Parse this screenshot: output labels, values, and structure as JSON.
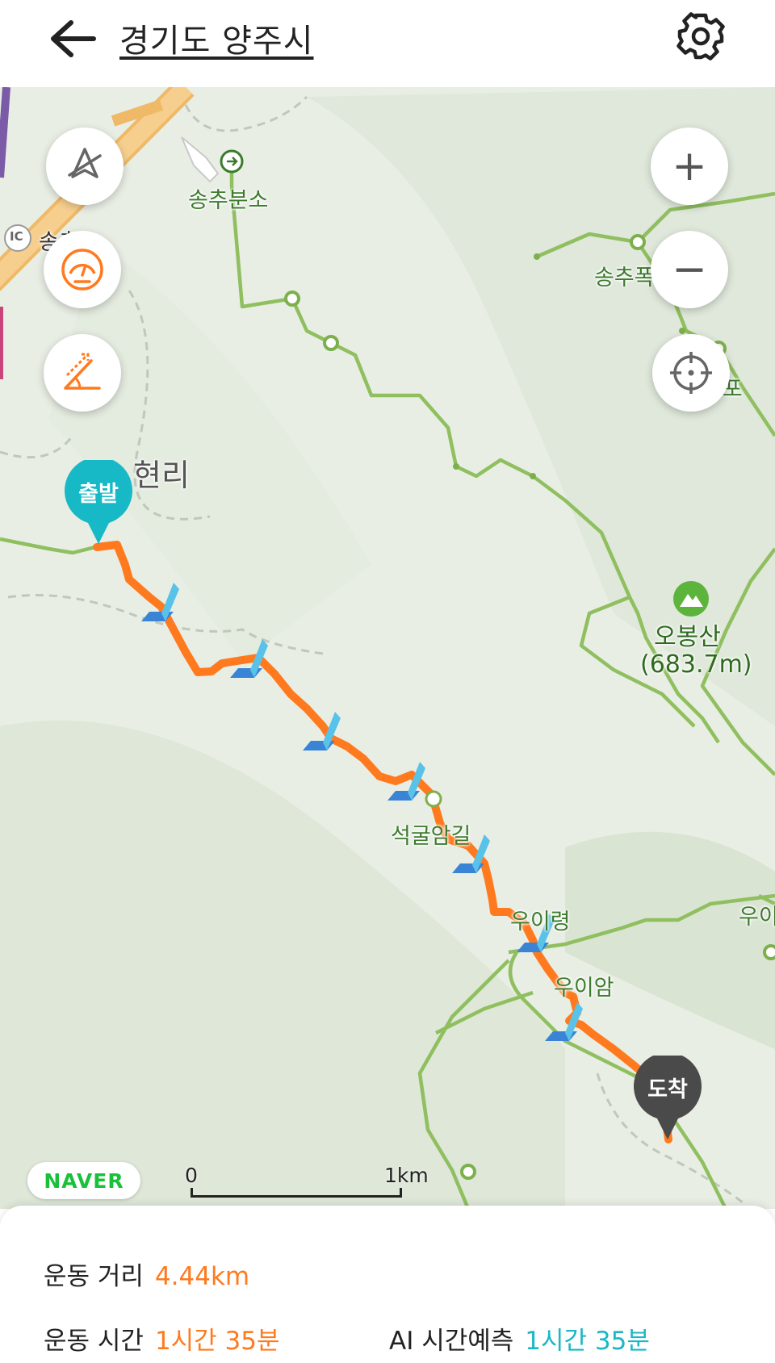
{
  "header": {
    "title": "경기도 양주시",
    "back_icon": "arrow-left-icon",
    "settings_icon": "gear-icon"
  },
  "map_controls": {
    "left": [
      "compass-off-icon",
      "speedometer-icon",
      "slope-angle-icon"
    ],
    "right": {
      "zoom_in": "+",
      "zoom_out": "−",
      "locate_icon": "crosshair-icon"
    }
  },
  "route": {
    "start_label": "출발",
    "end_label": "도착",
    "color": "#ff7a1f",
    "start_color": "#17b9c6",
    "end_color": "#4a4a4a"
  },
  "map_labels": {
    "songchu_branch": "송추분소",
    "ic": "IC",
    "ic_name": "송추",
    "village": "현리",
    "songchu_falls": "송추폭포",
    "falls_partial": "폭포",
    "obongsan": "오봉산",
    "obongsan_height": "(683.7m)",
    "seokgul": "석굴암길",
    "uiryeong": "우이령",
    "uiam": "우이암",
    "ui_right": "우이"
  },
  "scale_bar": {
    "left": "0",
    "right": "1km"
  },
  "brand": "NAVER",
  "stats": {
    "distance_label": "운동 거리",
    "distance_value": "4.44km",
    "time_label": "운동 시간",
    "time_value": "1시간 35분",
    "ai_label": "AI 시간예측",
    "ai_value": "1시간 35분"
  },
  "colors": {
    "accent_orange": "#ff7a1f",
    "accent_teal": "#1bb7c6",
    "trail_green": "#8fbf5f"
  }
}
